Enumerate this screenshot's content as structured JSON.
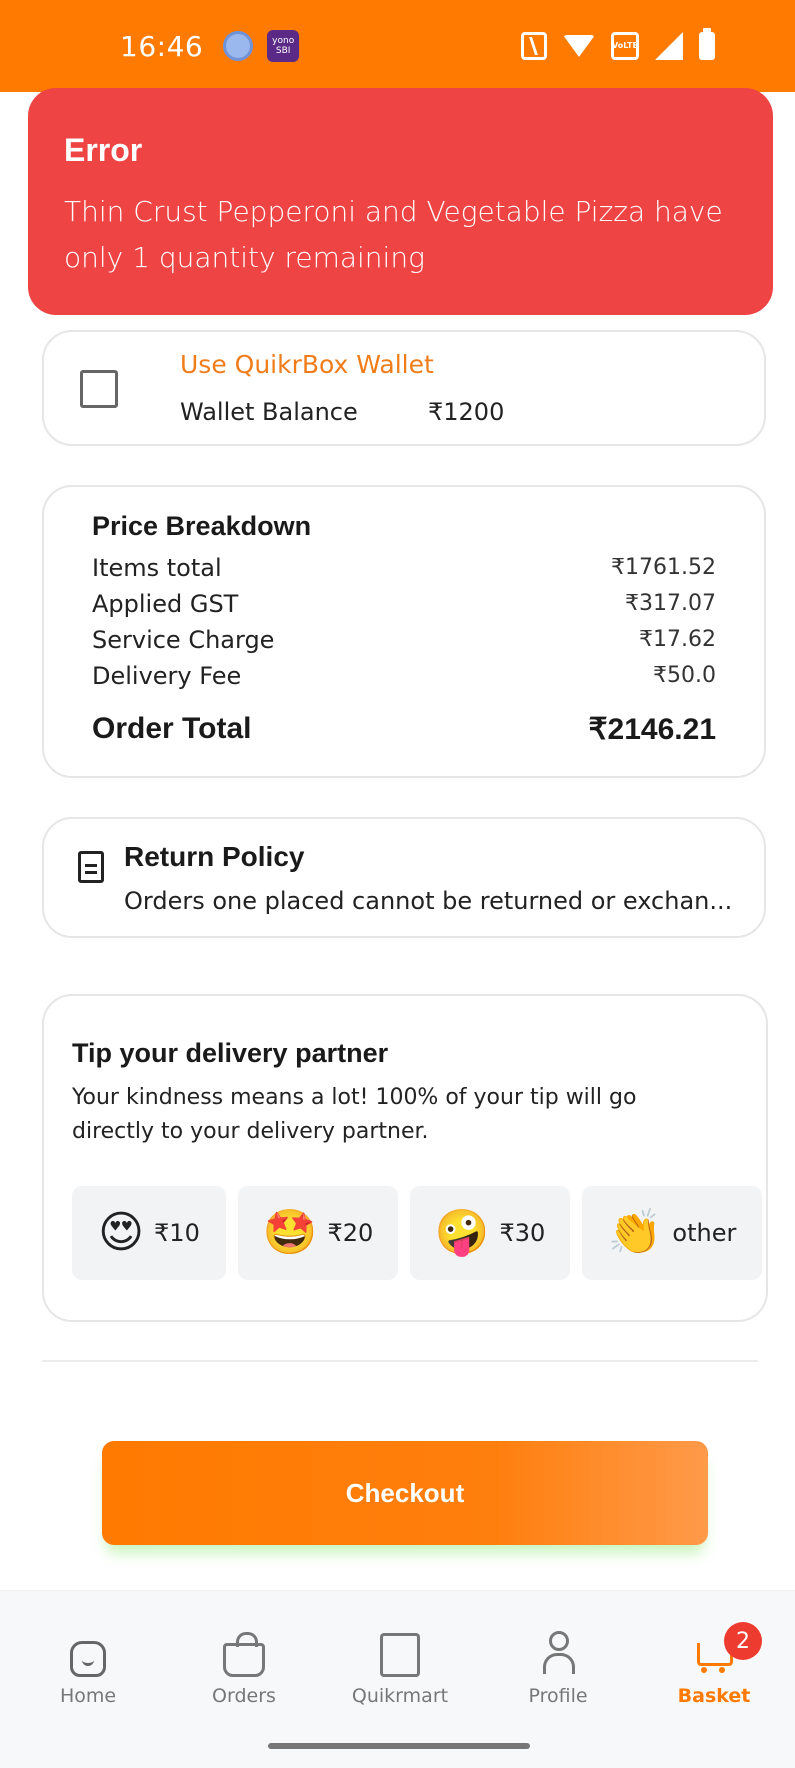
{
  "status_bar": {
    "time": "16:46",
    "app_badge": "yono",
    "app_badge_sub": "SBI",
    "volte_label": "VoLTE",
    "icons": [
      "browser-icon",
      "yono-app-icon",
      "nfc-icon",
      "wifi-icon",
      "volte-icon",
      "signal-icon",
      "battery-icon"
    ]
  },
  "error": {
    "title": "Error",
    "message": "Thin Crust Pepperoni and Vegetable Pizza have only 1 quantity remaining",
    "color": "#ee4444"
  },
  "wallet": {
    "title": "Use QuikrBox Wallet",
    "balance_label": "Wallet Balance",
    "balance_value": "₹1200",
    "checked": false
  },
  "price": {
    "title": "Price Breakdown",
    "rows": [
      {
        "label": "Items total",
        "value": "₹1761.52"
      },
      {
        "label": "Applied GST",
        "value": "₹317.07"
      },
      {
        "label": "Service Charge",
        "value": "₹17.62"
      },
      {
        "label": "Delivery Fee",
        "value": "₹50.0"
      }
    ],
    "total_label": "Order Total",
    "total_value": "₹2146.21"
  },
  "return_policy": {
    "title": "Return Policy",
    "text": "Orders one placed cannot be returned or exchan..."
  },
  "tip": {
    "title": "Tip your delivery partner",
    "description": "Your kindness means a lot! 100% of your tip will go directly to your delivery partner.",
    "options": [
      {
        "emoji": "😍",
        "label": "₹10"
      },
      {
        "emoji": "🤩",
        "label": "₹20"
      },
      {
        "emoji": "🤪",
        "label": "₹30"
      },
      {
        "emoji": "👏",
        "label": "other"
      }
    ]
  },
  "checkout": {
    "label": "Checkout",
    "accent": "#ff7a00"
  },
  "nav": {
    "items": [
      {
        "label": "Home",
        "icon": "home-icon"
      },
      {
        "label": "Orders",
        "icon": "orders-icon"
      },
      {
        "label": "Quikrmart",
        "icon": "quikrmart-icon"
      },
      {
        "label": "Profile",
        "icon": "profile-icon"
      },
      {
        "label": "Basket",
        "icon": "basket-icon",
        "badge": "2",
        "active": true
      }
    ]
  }
}
